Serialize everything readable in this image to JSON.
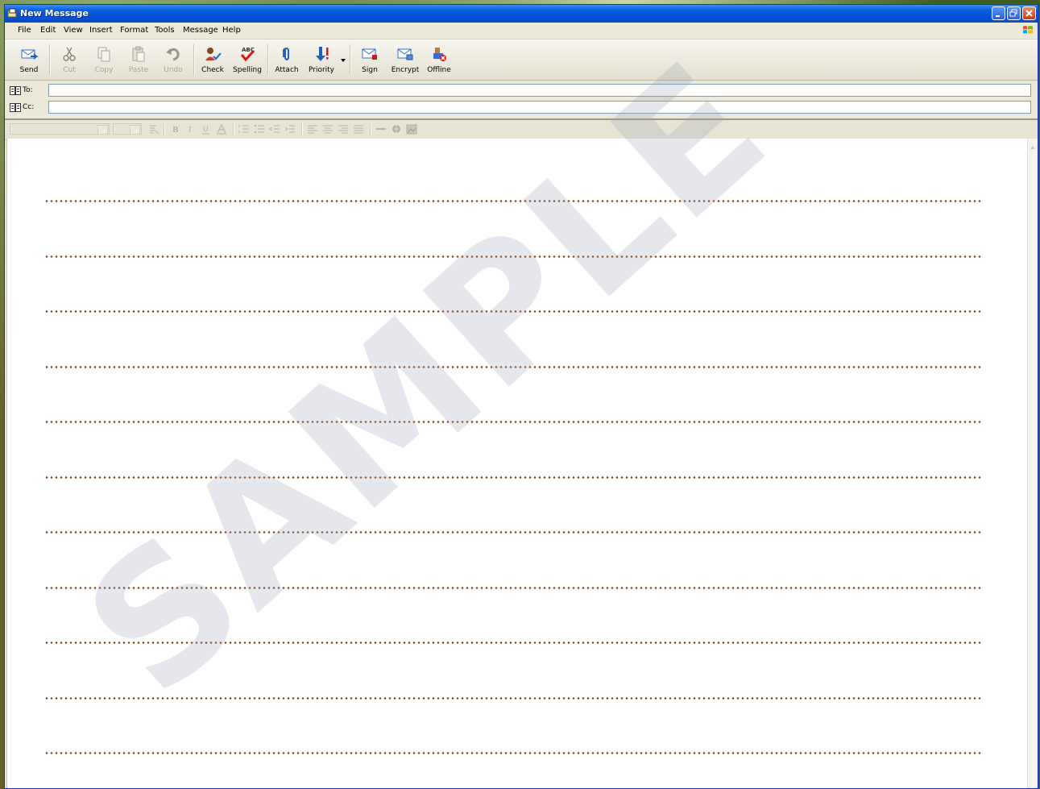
{
  "window": {
    "title": "New Message"
  },
  "menubar": {
    "items": [
      "File",
      "Edit",
      "View",
      "Insert",
      "Format",
      "Tools",
      "Message",
      "Help"
    ]
  },
  "toolbar": {
    "send": "Send",
    "cut": "Cut",
    "copy": "Copy",
    "paste": "Paste",
    "undo": "Undo",
    "check": "Check",
    "spelling": "Spelling",
    "attach": "Attach",
    "priority": "Priority",
    "sign": "Sign",
    "encrypt": "Encrypt",
    "offline": "Offline"
  },
  "address": {
    "to_label": "To:",
    "to_value": "",
    "cc_label": "Cc:",
    "cc_value": ""
  },
  "formatbar": {
    "font_value": "",
    "size_value": ""
  },
  "body": {
    "line_count": 11
  },
  "watermark": {
    "text": "SAMPLE"
  },
  "colors": {
    "titlebar": "#0a5fe0",
    "dotted_line": "#8a4a1c",
    "window_face": "#ece9d8"
  }
}
